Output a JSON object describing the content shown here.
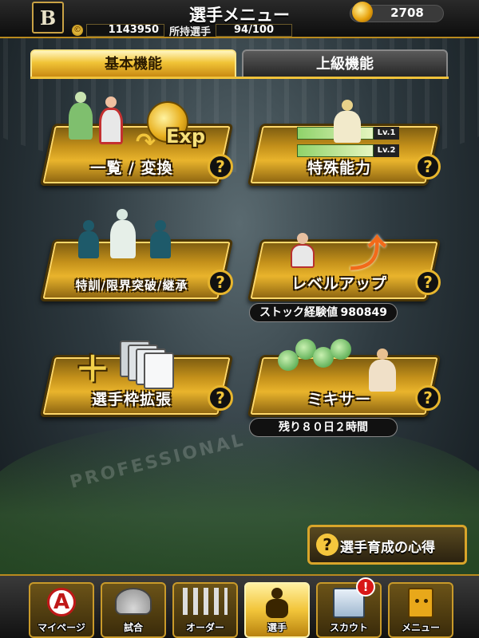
{
  "header": {
    "title": "選手メニュー",
    "team_logo": "B",
    "balls": "2708",
    "coins": "1143950",
    "players_label": "所持選手",
    "players_count": "94/100"
  },
  "tabs": [
    {
      "label": "基本機能",
      "active": true
    },
    {
      "label": "上級機能",
      "active": false
    }
  ],
  "cards": {
    "list_convert": {
      "label": "一覧 / 変換",
      "exp": "Exp"
    },
    "special": {
      "label": "特殊能力",
      "lv1": "Lv.1",
      "lv2": "Lv.2"
    },
    "training": {
      "label": "特訓/限界突破/継承"
    },
    "levelup": {
      "label": "レベルアップ",
      "stock_label": "ストック経験値",
      "stock_value": "980849"
    },
    "expand": {
      "label": "選手枠拡張"
    },
    "mixer": {
      "label": "ミキサー",
      "remaining": "残り８０日２時間"
    }
  },
  "help_glyph": "?",
  "tip_button": {
    "label": "選手育成の心得",
    "icon": "?"
  },
  "watermark": {
    "sub": "PROFESSIONAL"
  },
  "bottom_nav": [
    {
      "label": "マイページ",
      "icon": "A",
      "active": false
    },
    {
      "label": "試合",
      "icon": "field-icon",
      "active": false
    },
    {
      "label": "オーダー",
      "icon": "order-icon",
      "active": false
    },
    {
      "label": "選手",
      "icon": "player-icon",
      "active": true
    },
    {
      "label": "スカウト",
      "icon": "scout-icon",
      "active": false,
      "badge": "!"
    },
    {
      "label": "メニュー",
      "icon": "menu-icon",
      "active": false
    }
  ],
  "colors": {
    "gold": "#e9b42c",
    "dark": "#111111",
    "alert": "#d81818"
  }
}
